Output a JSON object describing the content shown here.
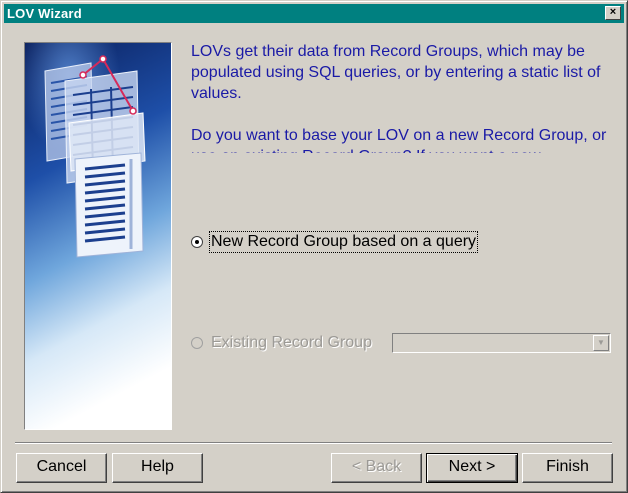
{
  "window": {
    "title": "LOV Wizard",
    "close_label": "×"
  },
  "description": {
    "paragraph1": "LOVs get their data from Record Groups, which may be populated using SQL queries, or by entering a static list of values.",
    "paragraph2": "Do you want to base your LOV on a new Record Group, or use an existing Record Group? If you want a new"
  },
  "options": {
    "new_group": {
      "label": "New Record Group based on a query",
      "selected": true
    },
    "existing_group": {
      "label": "Existing Record Group",
      "selected": false,
      "enabled": false,
      "value": ""
    }
  },
  "buttons": {
    "cancel": "Cancel",
    "help": "Help",
    "back": "< Back",
    "next": "Next >",
    "finish": "Finish"
  },
  "colors": {
    "title_bar": "#008080",
    "description_text": "#1a1aa6",
    "dialog_face": "#d4d0c8"
  }
}
